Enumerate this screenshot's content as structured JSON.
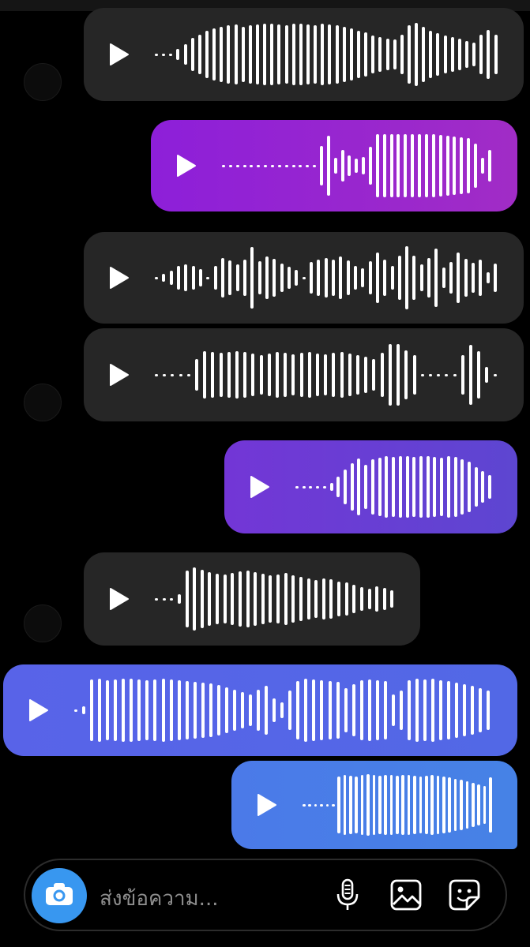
{
  "messages": [
    {
      "id": "m1",
      "side": "incoming",
      "color": "#262626",
      "bars": [
        3,
        3,
        3,
        14,
        26,
        42,
        50,
        60,
        66,
        70,
        74,
        76,
        70,
        74,
        76,
        78,
        78,
        76,
        74,
        78,
        78,
        76,
        74,
        78,
        76,
        74,
        70,
        66,
        60,
        56,
        48,
        44,
        40,
        38,
        50,
        74,
        80,
        70,
        60,
        54,
        48,
        44,
        40,
        34,
        30,
        50,
        62,
        50
      ]
    },
    {
      "id": "m2",
      "side": "outgoing",
      "color": "#8c1ed6",
      "bars": [
        3,
        3,
        3,
        3,
        3,
        3,
        3,
        3,
        3,
        3,
        3,
        3,
        3,
        3,
        50,
        76,
        20,
        40,
        26,
        18,
        22,
        48,
        80,
        80,
        80,
        80,
        80,
        80,
        80,
        80,
        80,
        78,
        76,
        74,
        72,
        70,
        56,
        20,
        40
      ]
    },
    {
      "id": "m3",
      "side": "incoming",
      "color": "#262626",
      "bars": [
        3,
        10,
        18,
        30,
        34,
        30,
        22,
        3,
        30,
        50,
        44,
        34,
        46,
        78,
        42,
        54,
        48,
        36,
        28,
        20,
        3,
        40,
        46,
        50,
        46,
        54,
        44,
        30,
        24,
        42,
        64,
        46,
        30,
        56,
        80,
        56,
        34,
        50,
        74,
        26,
        40,
        64,
        48,
        38,
        46,
        14,
        36
      ]
    },
    {
      "id": "m4",
      "side": "incoming",
      "color": "#262626",
      "bars": [
        3,
        3,
        3,
        3,
        3,
        40,
        60,
        58,
        56,
        58,
        60,
        58,
        54,
        50,
        54,
        58,
        56,
        52,
        56,
        58,
        54,
        52,
        56,
        58,
        54,
        50,
        46,
        40,
        56,
        78,
        78,
        62,
        50,
        3,
        3,
        3,
        3,
        3,
        50,
        76,
        60,
        20,
        3
      ]
    },
    {
      "id": "m5",
      "side": "outgoing",
      "color": "#6a3fd3",
      "bars": [
        3,
        3,
        3,
        3,
        3,
        10,
        26,
        44,
        60,
        72,
        56,
        70,
        74,
        78,
        76,
        78,
        78,
        76,
        78,
        78,
        76,
        74,
        78,
        76,
        70,
        64,
        50,
        40,
        30
      ]
    },
    {
      "id": "m6",
      "side": "incoming",
      "color": "#262626",
      "bars": [
        3,
        3,
        3,
        12,
        72,
        80,
        74,
        68,
        64,
        62,
        66,
        70,
        72,
        68,
        64,
        60,
        62,
        66,
        60,
        56,
        52,
        48,
        52,
        50,
        44,
        42,
        36,
        30,
        26,
        32,
        28,
        22
      ]
    },
    {
      "id": "m7",
      "side": "outgoing",
      "color": "#4f68ea",
      "bars": [
        3,
        10,
        78,
        80,
        76,
        78,
        80,
        80,
        78,
        76,
        78,
        80,
        78,
        76,
        74,
        72,
        70,
        68,
        64,
        58,
        52,
        46,
        40,
        52,
        62,
        30,
        20,
        50,
        74,
        80,
        78,
        76,
        74,
        72,
        56,
        66,
        76,
        78,
        76,
        74,
        40,
        50,
        76,
        80,
        78,
        80,
        76,
        74,
        70,
        66,
        62,
        56,
        50
      ]
    },
    {
      "id": "m8",
      "side": "outgoing",
      "color": "#4a7ee8",
      "bars": [
        3,
        3,
        3,
        3,
        3,
        3,
        72,
        76,
        74,
        72,
        76,
        78,
        76,
        74,
        76,
        76,
        74,
        76,
        76,
        74,
        72,
        74,
        76,
        74,
        72,
        70,
        66,
        64,
        60,
        56,
        52,
        48,
        70
      ]
    }
  ],
  "composer": {
    "placeholder": "ส่งข้อความ...",
    "camera_icon": "camera-icon",
    "mic_icon": "microphone-icon",
    "gallery_icon": "image-icon",
    "sticker_icon": "sticker-icon",
    "accent": "#3897f0"
  }
}
